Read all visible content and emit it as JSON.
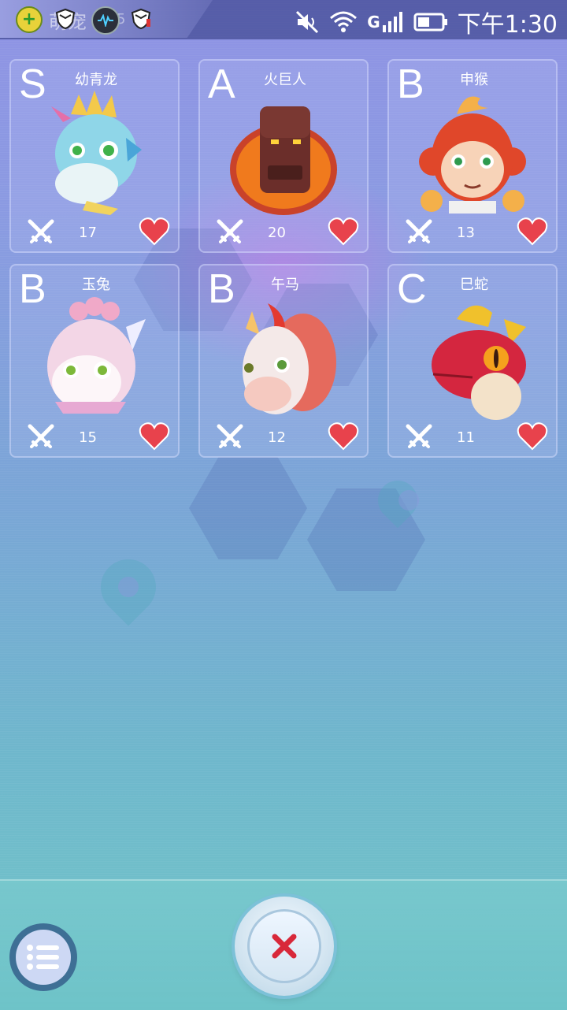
{
  "status_bar": {
    "app_name": "萌宠",
    "notification_count": "5",
    "time": "下午1:30",
    "network_label": "G",
    "icons": [
      "plus-app-icon",
      "shield-icon",
      "wave-icon",
      "shield-icon",
      "mute-icon",
      "wifi-icon",
      "signal-icon",
      "battery-icon"
    ]
  },
  "pets": [
    {
      "grade": "S",
      "name": "幼青龙",
      "fights": "17",
      "color": "#8fd6e8",
      "accent": "#f3c94a"
    },
    {
      "grade": "A",
      "name": "火巨人",
      "fights": "20",
      "color": "#6b2e2a",
      "accent": "#f07a1d"
    },
    {
      "grade": "B",
      "name": "申猴",
      "fights": "13",
      "color": "#e0472a",
      "accent": "#f4b04a"
    },
    {
      "grade": "B",
      "name": "玉兔",
      "fights": "15",
      "color": "#f3d6e6",
      "accent": "#f0a9c8"
    },
    {
      "grade": "B",
      "name": "午马",
      "fights": "12",
      "color": "#f4e9e8",
      "accent": "#e56a5d"
    },
    {
      "grade": "C",
      "name": "巳蛇",
      "fights": "11",
      "color": "#d4263f",
      "accent": "#f0c12c"
    }
  ],
  "colors": {
    "heart": "#e8424c",
    "grade_text": "#ffffff",
    "close_x": "#d8283a"
  },
  "bottom": {
    "menu_icon": "list-icon",
    "close_icon": "close-icon"
  }
}
